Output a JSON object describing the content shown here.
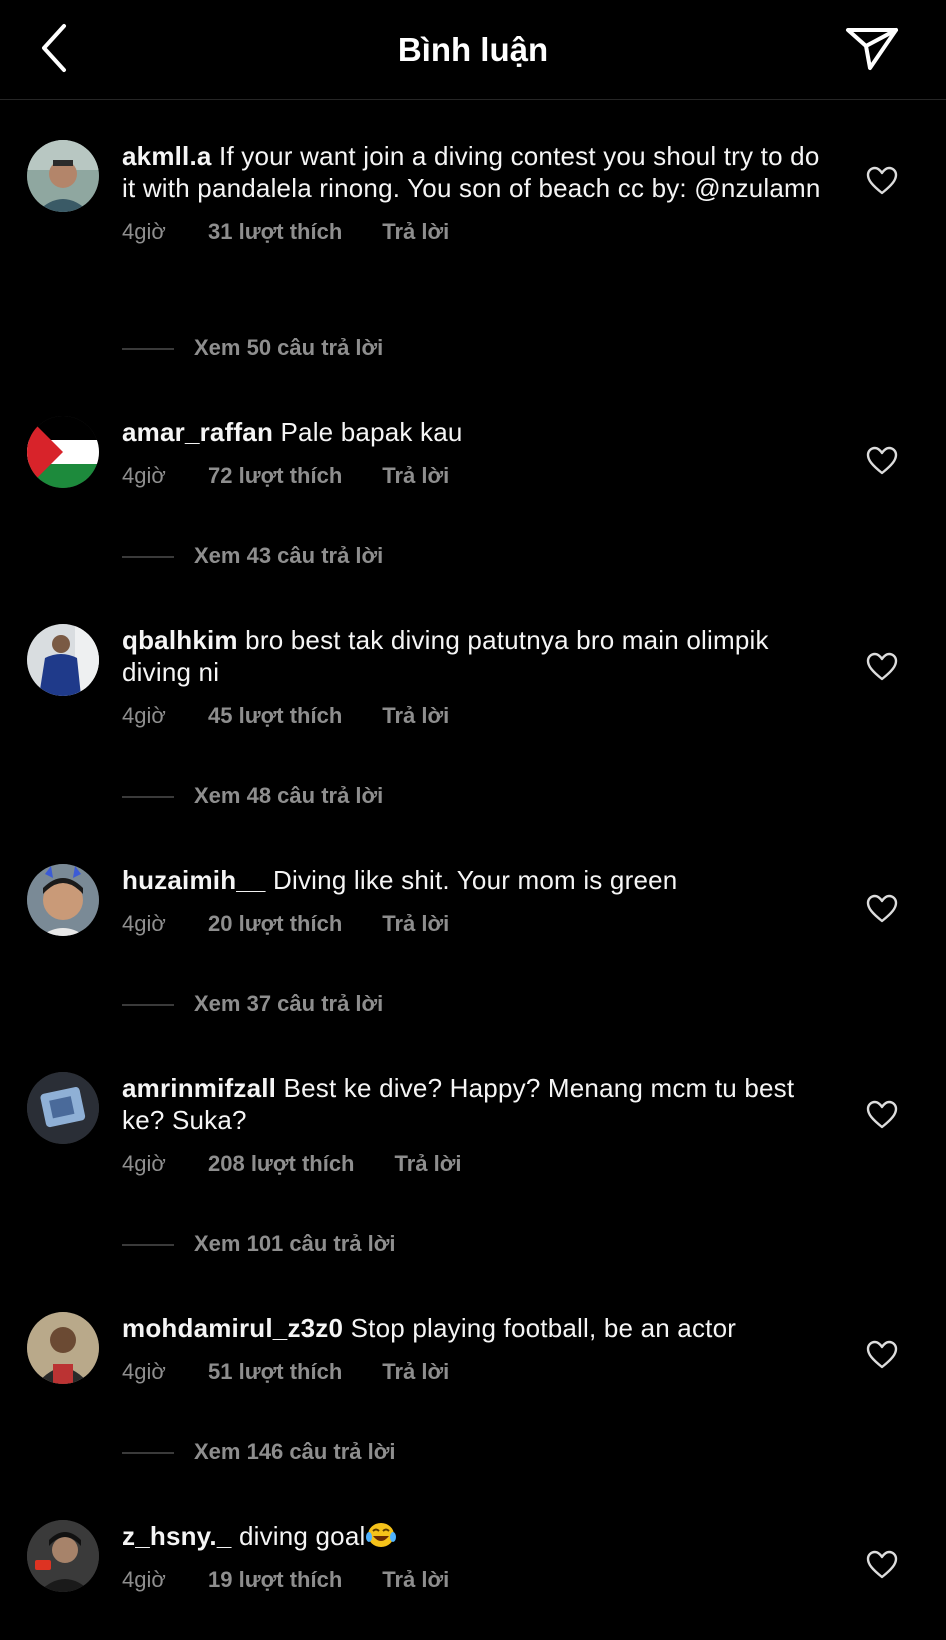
{
  "header": {
    "title": "Bình luận",
    "back_icon": "chevron-left-icon",
    "send_icon": "paper-plane-icon"
  },
  "comments": [
    {
      "username": "akmll.a",
      "text": "If your want join a diving contest you shoul try to do it with pandalela rinong. You son of beach cc by: @nzulamn",
      "time": "4giờ",
      "likes": "31 lượt thích",
      "reply": "Trả lời",
      "view_replies": "Xem 50 câu trả lời",
      "avatar": "person-photo"
    },
    {
      "username": "amar_raffan",
      "text": "Pale bapak kau",
      "time": "4giờ",
      "likes": "72 lượt thích",
      "reply": "Trả lời",
      "view_replies": "Xem 43 câu trả lời",
      "avatar": "palestine-flag"
    },
    {
      "username": "qbalhkim",
      "text": "bro best tak diving patutnya bro main olimpik diving ni",
      "time": "4giờ",
      "likes": "45 lượt thích",
      "reply": "Trả lời",
      "view_replies": "Xem 48 câu trả lời",
      "avatar": "person-photo"
    },
    {
      "username": "huzaimih__",
      "text": "Diving like shit. Your mom is green",
      "time": "4giờ",
      "likes": "20 lượt thích",
      "reply": "Trả lời",
      "view_replies": "Xem 37 câu trả lời",
      "avatar": "person-photo"
    },
    {
      "username": "amrinmifzall",
      "text": "Best ke dive? Happy? Menang mcm tu best ke? Suka?",
      "time": "4giờ",
      "likes": "208 lượt thích",
      "reply": "Trả lời",
      "view_replies": "Xem 101 câu trả lời",
      "avatar": "photo"
    },
    {
      "username": "mohdamirul_z3z0",
      "text": "Stop playing football, be an actor",
      "time": "4giờ",
      "likes": "51 lượt thích",
      "reply": "Trả lời",
      "view_replies": "Xem 146 câu trả lời",
      "avatar": "person-photo"
    },
    {
      "username": "z_hsny._",
      "text": "diving goal",
      "emoji": "😂",
      "time": "4giờ",
      "likes": "19 lượt thích",
      "reply": "Trả lời",
      "avatar": "person-photo"
    }
  ]
}
